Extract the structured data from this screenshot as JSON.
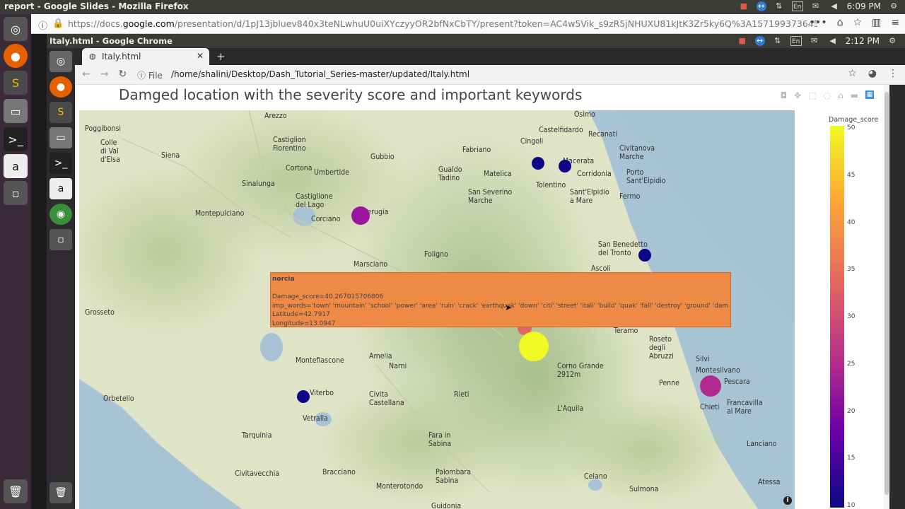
{
  "os": {
    "window_title": "report - Google Slides - Mozilla Firefox",
    "time": "6:09 PM",
    "lang": "En"
  },
  "firefox": {
    "url_prefix": "https://docs.",
    "url_domain": "google.com",
    "url_rest": "/presentation/d/1pJ13jbluev840x3teNLwhuU0uiXYczyyOR2bfNxCbTY/present?token=AC4w5Vik_s9zR5jNHUXU81kJtK3Zr5ky6Q%3A1571993736451&includes_info_paran",
    "more": "•••"
  },
  "chrome": {
    "window_title": "Italy.html - Google Chrome",
    "time": "2:12 PM",
    "lang": "En",
    "tab_label": "Italy.html",
    "info_label": "File",
    "path": "/home/shalini/Desktop/Dash_Tutorial_Series-master/updated/Italy.html"
  },
  "plot": {
    "title": "Damged location with the severity score and important keywords",
    "colorbar_title": "Damage_score",
    "colorbar_ticks": [
      "50",
      "45",
      "40",
      "35",
      "30",
      "25",
      "20",
      "15",
      "10"
    ]
  },
  "cities": [
    {
      "name": "Arezzo"
    },
    {
      "name": "Poggibonsi"
    },
    {
      "name": "Colle\ndi Val\nd'Elsa"
    },
    {
      "name": "Siena"
    },
    {
      "name": "Castiglion\nFiorentino"
    },
    {
      "name": "Cortona"
    },
    {
      "name": "Umbertide"
    },
    {
      "name": "Gubbio"
    },
    {
      "name": "Sinalunga"
    },
    {
      "name": "Montepulciano"
    },
    {
      "name": "Castiglione\ndel Lago"
    },
    {
      "name": "Corciano"
    },
    {
      "name": "Perugia"
    },
    {
      "name": "Fabriano"
    },
    {
      "name": "Gualdo\nTadino"
    },
    {
      "name": "Matelica"
    },
    {
      "name": "San Severino\nMarche"
    },
    {
      "name": "Osimo"
    },
    {
      "name": "Castelfidardo"
    },
    {
      "name": "Recanati"
    },
    {
      "name": "Cingoli"
    },
    {
      "name": "Macerata"
    },
    {
      "name": "Corridonia"
    },
    {
      "name": "Civitanova\nMarche"
    },
    {
      "name": "Porto\nSant'Elpidio"
    },
    {
      "name": "Tolentino"
    },
    {
      "name": "Sant'Elpidio\na Mare"
    },
    {
      "name": "Fermo"
    },
    {
      "name": "San Benedetto\ndel Tronto"
    },
    {
      "name": "Ascoli"
    },
    {
      "name": "Foligno"
    },
    {
      "name": "Marsciano"
    },
    {
      "name": "Grosseto"
    },
    {
      "name": "Montefiascone"
    },
    {
      "name": "Amelia"
    },
    {
      "name": "Narni"
    },
    {
      "name": "Orbetello"
    },
    {
      "name": "Viterbo"
    },
    {
      "name": "Vetralla"
    },
    {
      "name": "Civita\nCastellana"
    },
    {
      "name": "Rieti"
    },
    {
      "name": "Tarquinia"
    },
    {
      "name": "Fara in\nSabina"
    },
    {
      "name": "Teramo"
    },
    {
      "name": "Roseto\ndegli\nAbruzzi"
    },
    {
      "name": "Silvi"
    },
    {
      "name": "Montesilvano"
    },
    {
      "name": "Pescara"
    },
    {
      "name": "Penne"
    },
    {
      "name": "Chieti"
    },
    {
      "name": "Francavilla\nal Mare"
    },
    {
      "name": "Corno Grande\n2912m"
    },
    {
      "name": "L'Aquila"
    },
    {
      "name": "Lanciano"
    },
    {
      "name": "Civitavecchia"
    },
    {
      "name": "Bracciano"
    },
    {
      "name": "Monterotondo"
    },
    {
      "name": "Palombara\nSabina"
    },
    {
      "name": "Celano"
    },
    {
      "name": "Sulmona"
    },
    {
      "name": "Atessa"
    },
    {
      "name": "Guidonia"
    }
  ],
  "markers": [
    {
      "name": "cingoli-marker",
      "color": "#0d0887"
    },
    {
      "name": "macerata-marker",
      "color": "#0d0887"
    },
    {
      "name": "perugia-marker",
      "color": "#9c179e"
    },
    {
      "name": "sanbenedetto-marker",
      "color": "#0d0887"
    },
    {
      "name": "norcia-marker",
      "color": "#e16462"
    },
    {
      "name": "amatrice-marker",
      "color": "#f0f921"
    },
    {
      "name": "pescara-marker",
      "color": "#b12a90"
    },
    {
      "name": "viterbo-marker",
      "color": "#0d0887"
    }
  ],
  "hover": {
    "name": "norcia",
    "score": "Damage_score=40.267015706806",
    "words": "imp_words='town' 'mountain' 'school' 'power' 'area' 'ruin' 'crack' 'earthquak' 'down' 'citi' 'street' 'itali' 'build' 'quak' 'fall' 'destroy' 'ground' 'damag'",
    "lat": "Latitude=42.7917",
    "lon": "Longitude=13.0947"
  }
}
